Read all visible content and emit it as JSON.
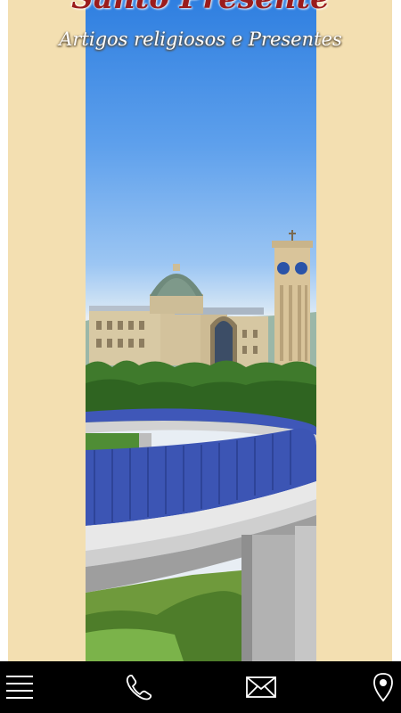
{
  "header": {
    "store_name": "Santo Presente",
    "tagline": "Artigos religiosos e Presentes"
  },
  "colors": {
    "banner_background": "#f3dfb1",
    "store_name": "#9b1c1c",
    "bottom_bar": "#000000",
    "icon_color": "#ffffff"
  },
  "bottom_nav": [
    {
      "icon": "menu-icon"
    },
    {
      "icon": "phone-icon"
    },
    {
      "icon": "mail-icon"
    },
    {
      "icon": "map-pin-icon"
    }
  ]
}
